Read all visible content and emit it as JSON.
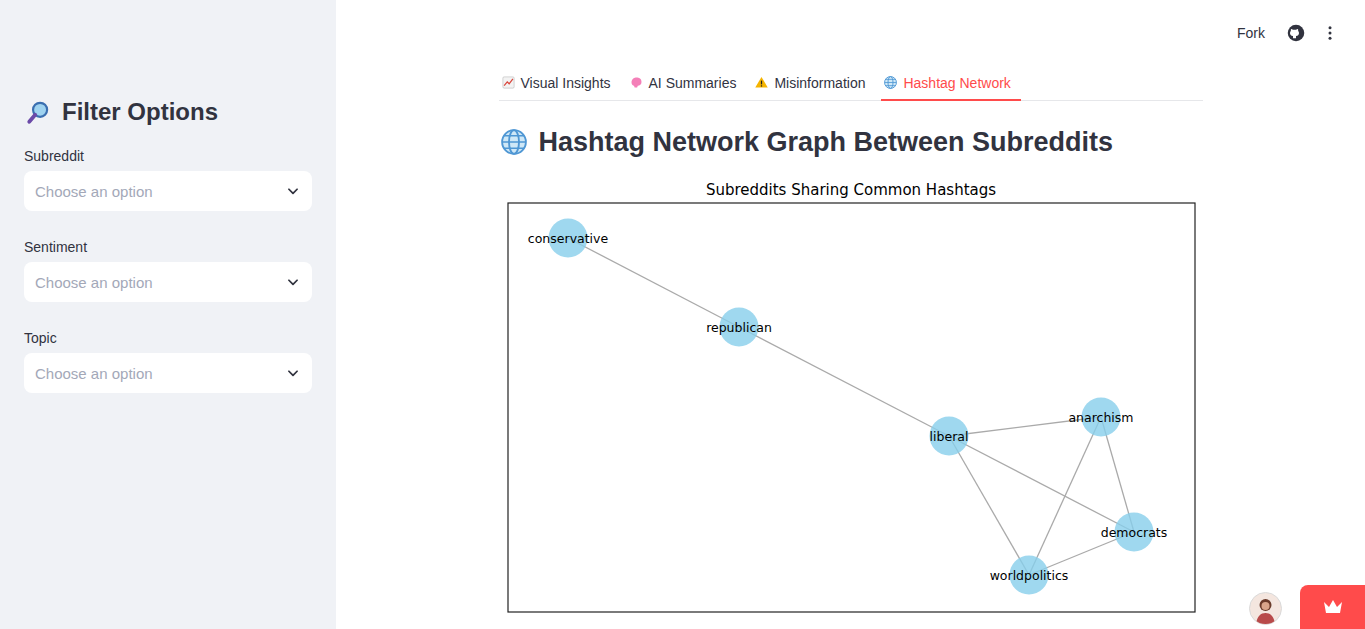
{
  "sidebar": {
    "title": "Filter Options",
    "filters": [
      {
        "label": "Subreddit",
        "placeholder": "Choose an option"
      },
      {
        "label": "Sentiment",
        "placeholder": "Choose an option"
      },
      {
        "label": "Topic",
        "placeholder": "Choose an option"
      }
    ]
  },
  "header": {
    "fork": "Fork"
  },
  "tabs": [
    {
      "label": "Visual Insights",
      "selected": false
    },
    {
      "label": "AI Summaries",
      "selected": false
    },
    {
      "label": "Misinformation",
      "selected": false
    },
    {
      "label": "Hashtag Network",
      "selected": true
    }
  ],
  "heading": "Hashtag Network Graph Between Subreddits",
  "chart": {
    "title": "Subreddits Sharing Common Hashtags",
    "nodes": [
      "conservative",
      "republican",
      "liberal",
      "anarchism",
      "democrats",
      "worldpolitics"
    ],
    "edges": [
      [
        0,
        1
      ],
      [
        1,
        2
      ],
      [
        2,
        3
      ],
      [
        2,
        4
      ],
      [
        2,
        5
      ],
      [
        3,
        4
      ],
      [
        3,
        5
      ],
      [
        4,
        5
      ]
    ]
  }
}
